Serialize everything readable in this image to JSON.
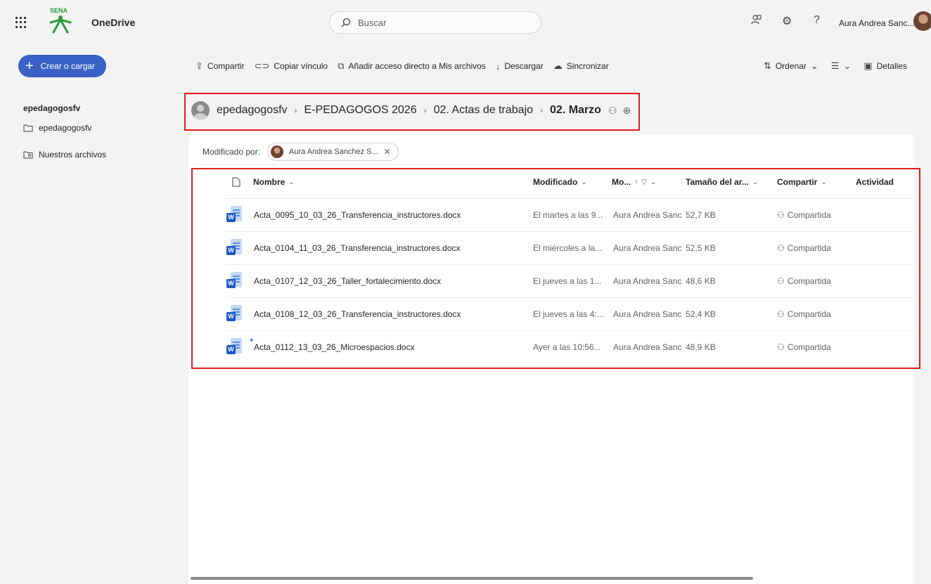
{
  "app": {
    "name": "OneDrive",
    "logo_text": "SENA"
  },
  "search": {
    "placeholder": "Buscar"
  },
  "user": {
    "name": "Aura Andrea Sanc..."
  },
  "nav": {
    "create_label": "Crear o cargar",
    "title": "epedagogosfv",
    "items": [
      {
        "label": "epedagogosfv",
        "icon": "folder-icon"
      },
      {
        "label": "Nuestros archivos",
        "icon": "shared-files-icon"
      }
    ]
  },
  "toolbar": {
    "share": "Compartir",
    "copy_link": "Copiar vínculo",
    "add_shortcut": "Añadir acceso directo a Mis archivos",
    "download": "Descargar",
    "sync": "Sincronizar",
    "sort": "Ordenar",
    "details": "Detalles"
  },
  "breadcrumb": {
    "items": [
      "epedagogosfv",
      "E-PEDAGOGOS 2026",
      "02. Actas de trabajo",
      "02. Marzo"
    ]
  },
  "filter": {
    "label": "Modificado por:",
    "chip": "Aura Andrea Sanchez S..."
  },
  "table": {
    "headers": {
      "name": "Nombre",
      "modified": "Modificado",
      "modified_by": "Mo...",
      "size": "Tamaño del ar...",
      "sharing": "Compartir",
      "activity": "Actividad"
    },
    "rows": [
      {
        "name": "Acta_0095_10_03_26_Transferencia_instructores.docx",
        "modified": "El martes a las 9...",
        "modified_by": "Aura Andrea Sanc",
        "size": "52,7 KB",
        "sharing": "Compartida",
        "is_new": false
      },
      {
        "name": "Acta_0104_11_03_26_Transferencia_instructores.docx",
        "modified": "El miércoles a la...",
        "modified_by": "Aura Andrea Sanc",
        "size": "52,5 KB",
        "sharing": "Compartida",
        "is_new": false
      },
      {
        "name": "Acta_0107_12_03_26_Taller_fortalecimiento.docx",
        "modified": "El jueves a las 1...",
        "modified_by": "Aura Andrea Sanc",
        "size": "48,6 KB",
        "sharing": "Compartida",
        "is_new": false
      },
      {
        "name": "Acta_0108_12_03_26_Transferencia_instructores.docx",
        "modified": "El jueves a las 4:...",
        "modified_by": "Aura Andrea Sanc",
        "size": "52,4 KB",
        "sharing": "Compartida",
        "is_new": false
      },
      {
        "name": "Acta_0112_13_03_26_Microespacios.docx",
        "modified": "Ayer a las 10:56...",
        "modified_by": "Aura Andrea Sanc",
        "size": "48,9 KB",
        "sharing": "Compartida",
        "is_new": true
      }
    ]
  },
  "colors": {
    "accent": "#3a62c6",
    "highlight": "#e11c1c",
    "word": "#1b58c7"
  }
}
